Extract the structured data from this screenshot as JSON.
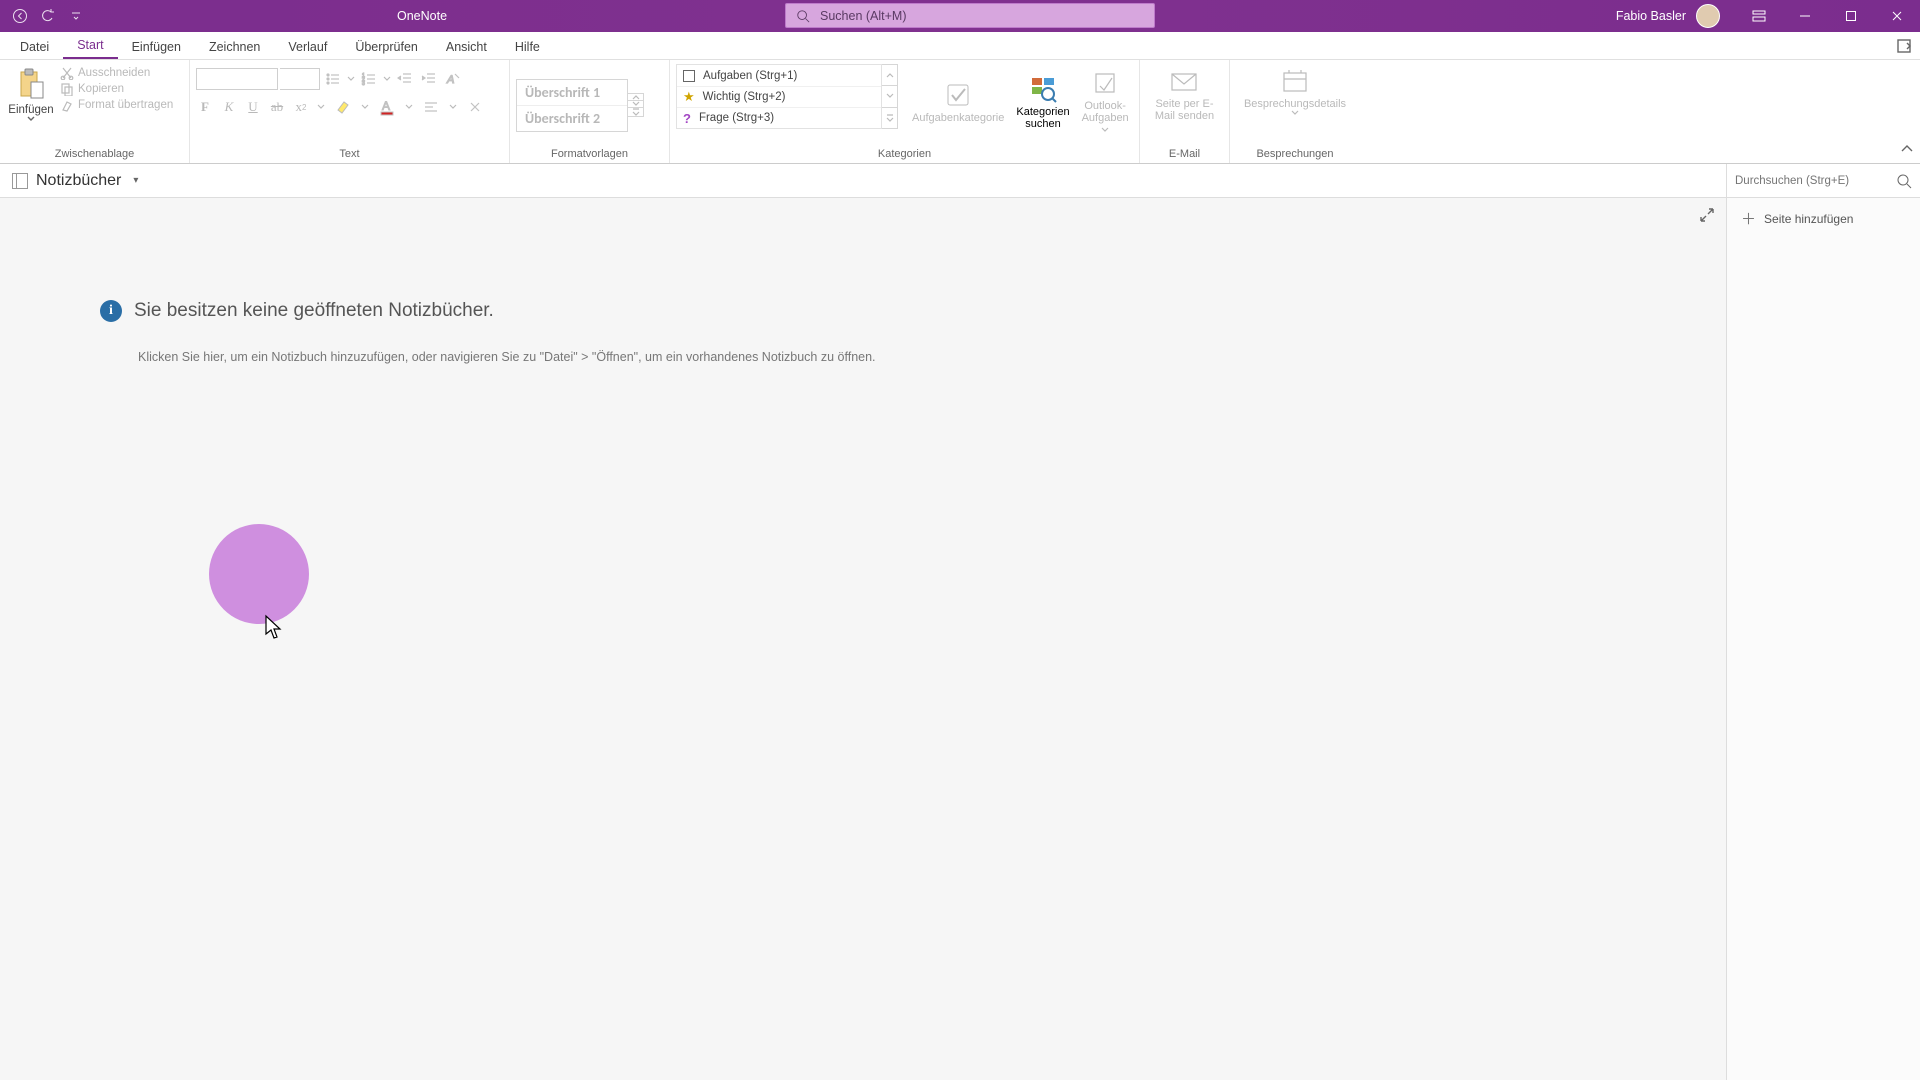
{
  "app": {
    "title": "OneNote"
  },
  "user": {
    "name": "Fabio Basler"
  },
  "search": {
    "placeholder": "Suchen (Alt+M)"
  },
  "tabs": {
    "datei": "Datei",
    "start": "Start",
    "einfuegen": "Einfügen",
    "zeichnen": "Zeichnen",
    "verlauf": "Verlauf",
    "ueberpruefen": "Überprüfen",
    "ansicht": "Ansicht",
    "hilfe": "Hilfe"
  },
  "ribbon": {
    "clipboard": {
      "paste": "Einfügen",
      "cut": "Ausschneiden",
      "copy": "Kopieren",
      "format": "Format übertragen",
      "label": "Zwischenablage"
    },
    "text": {
      "label": "Text"
    },
    "styles": {
      "h1": "Überschrift 1",
      "h2": "Überschrift 2",
      "label": "Formatvorlagen"
    },
    "tags": {
      "todo": "Aufgaben (Strg+1)",
      "important": "Wichtig (Strg+2)",
      "question": "Frage (Strg+3)",
      "todo_cat": "Aufgabenkategorie",
      "find_cat_1": "Kategorien",
      "find_cat_2": "suchen",
      "outlook_1": "Outlook-",
      "outlook_2": "Aufgaben",
      "label": "Kategorien"
    },
    "email": {
      "send_1": "Seite per E-",
      "send_2": "Mail senden",
      "label": "E-Mail"
    },
    "meetings": {
      "details": "Besprechungsdetails",
      "label": "Besprechungen"
    }
  },
  "notebook_bar": {
    "title": "Notizbücher",
    "search_placeholder": "Durchsuchen (Strg+E)"
  },
  "side": {
    "add_page": "Seite hinzufügen"
  },
  "message": {
    "title": "Sie besitzen keine geöffneten Notizbücher.",
    "sub": "Klicken Sie hier, um ein Notizbuch hinzuzufügen, oder navigieren Sie zu \"Datei\" > \"Öffnen\", um ein vorhandenes Notizbuch zu öffnen."
  },
  "colors": {
    "accent": "#7b2d8e"
  }
}
